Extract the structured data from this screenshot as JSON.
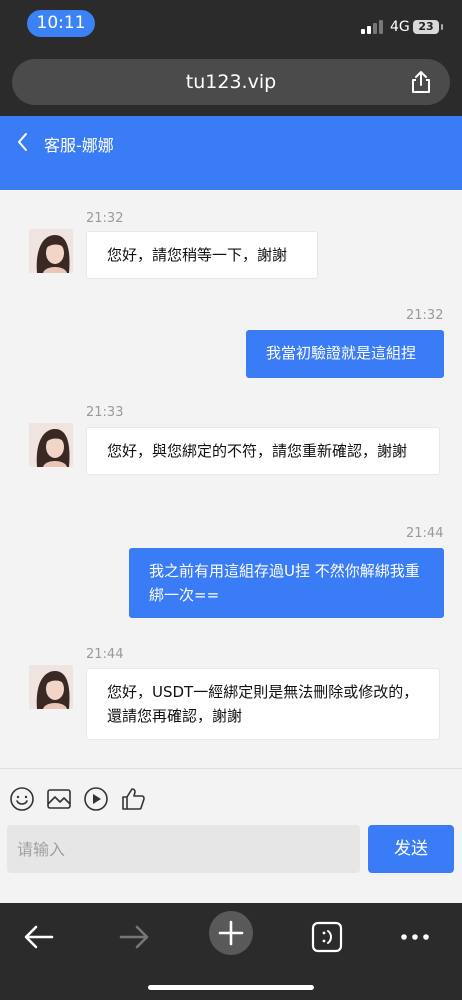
{
  "status_bar": {
    "time": "10:11",
    "network": "4G",
    "battery": "23"
  },
  "browser": {
    "url": "tu123.vip"
  },
  "header": {
    "title": "客服-娜娜"
  },
  "messages": [
    {
      "time": "21:32",
      "direction": "in",
      "text": "您好，請您稍等一下，謝謝"
    },
    {
      "time": "21:32",
      "direction": "out",
      "text": "我當初驗證就是這組捏"
    },
    {
      "time": "21:33",
      "direction": "in",
      "text": "您好，與您綁定的不符，請您重新確認，謝謝"
    },
    {
      "time": "21:44",
      "direction": "out",
      "text": "我之前有用這組存過U捏 不然你解綁我重綁一次=="
    },
    {
      "time": "21:44",
      "direction": "in",
      "text": "您好，USDT一經綁定則是無法刪除或修改的，還請您再確認，謝謝"
    }
  ],
  "composer": {
    "placeholder": "请输入",
    "send_label": "发送"
  },
  "toolbar_icons": [
    "smiley-icon",
    "image-icon",
    "video-icon",
    "thumbs-up-icon"
  ],
  "nav_icons": [
    "back-arrow-icon",
    "forward-arrow-icon",
    "new-tab-icon",
    "tabs-icon",
    "more-icon"
  ],
  "colors": {
    "accent": "#3a7cf5",
    "chrome": "#2b2b2b",
    "background": "#f3f3f3"
  }
}
